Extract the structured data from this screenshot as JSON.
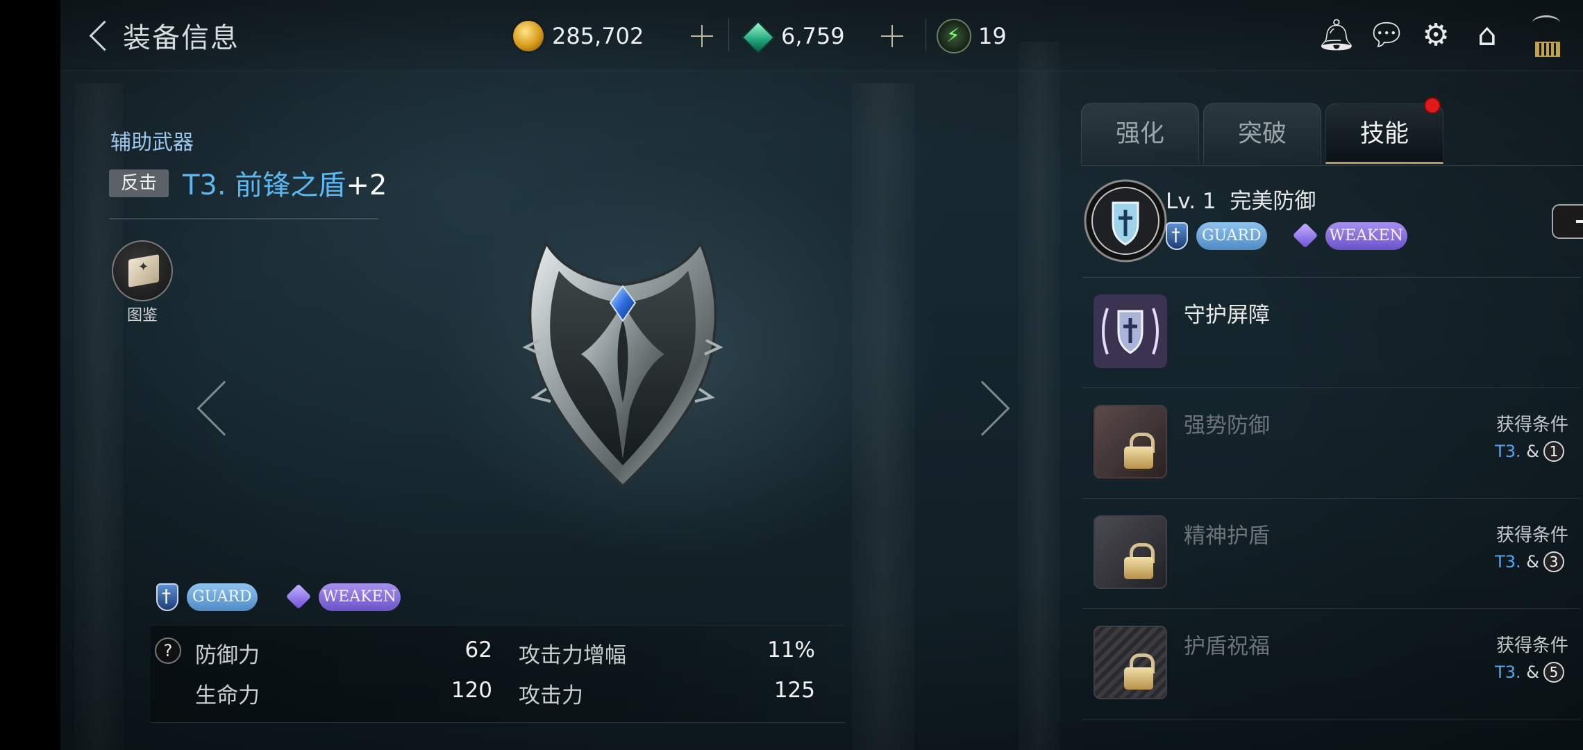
{
  "header": {
    "title": "装备信息"
  },
  "currencies": {
    "gold": "285,702",
    "gems": "6,759",
    "energy": "19"
  },
  "item": {
    "category": "辅助武器",
    "type_badge": "反击",
    "name": "T3. 前锋之盾",
    "enhance": "+2",
    "collection_label": "图鉴"
  },
  "tags": {
    "guard": "GUARD",
    "weaken": "WEAKEN"
  },
  "stats": [
    {
      "label": "防御力",
      "value": "62"
    },
    {
      "label": "攻击力增幅",
      "value": "11%"
    },
    {
      "label": "生命力",
      "value": "120"
    },
    {
      "label": "攻击力",
      "value": "125"
    }
  ],
  "tabs": [
    "强化",
    "突破",
    "技能"
  ],
  "active_tab": "技能",
  "skills": {
    "main": {
      "level": "Lv. 1",
      "name": "完美防御"
    },
    "list": [
      {
        "name": "守护屏障",
        "locked": false
      },
      {
        "name": "强势防御",
        "locked": true,
        "condition_label": "获得条件",
        "tier": "T3.",
        "amp": "&",
        "req": "1"
      },
      {
        "name": "精神护盾",
        "locked": true,
        "condition_label": "获得条件",
        "tier": "T3.",
        "amp": "&",
        "req": "3"
      },
      {
        "name": "护盾祝福",
        "locked": true,
        "condition_label": "获得条件",
        "tier": "T3.",
        "amp": "&",
        "req": "5"
      }
    ]
  },
  "colors": {
    "accent_blue": "#5cb8f2",
    "tab_underline": "#b49a5e",
    "notification": "#e21a1a"
  }
}
